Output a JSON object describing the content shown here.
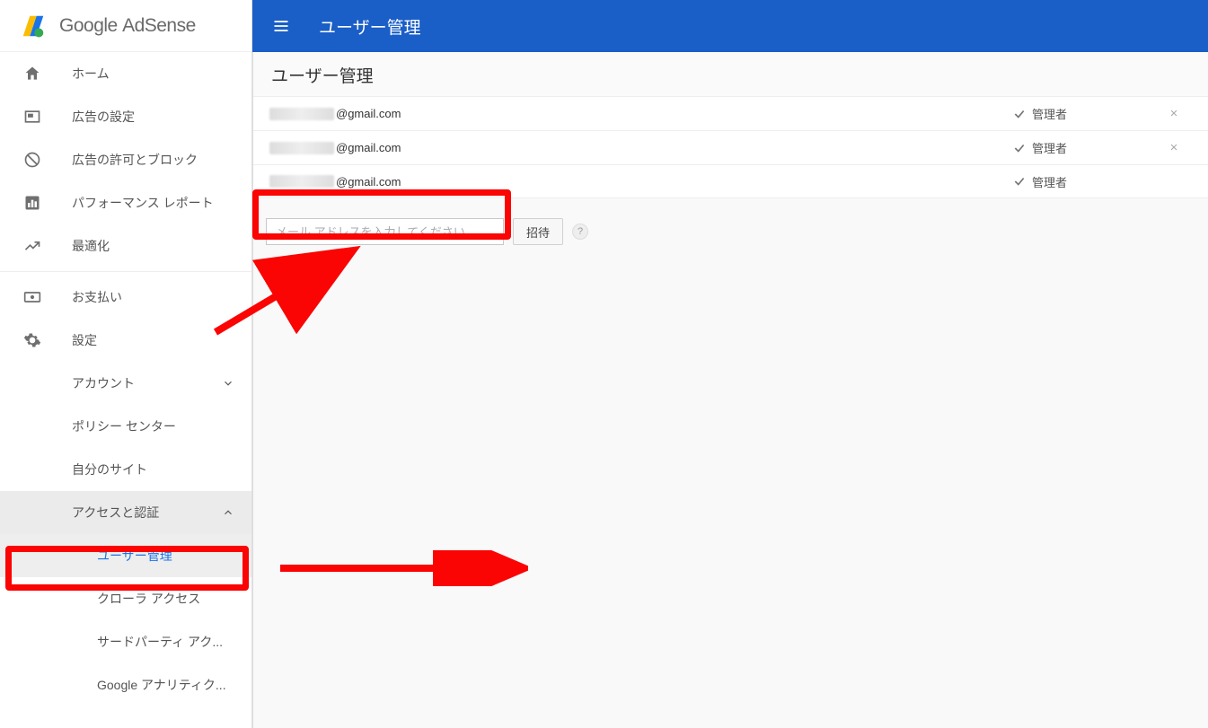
{
  "brand": {
    "google": "Google",
    "product": "AdSense"
  },
  "header": {
    "title": "ユーザー管理"
  },
  "nav": {
    "home": "ホーム",
    "ads": "広告の設定",
    "allow": "広告の許可とブロック",
    "perf": "パフォーマンス レポート",
    "opt": "最適化",
    "pay": "お支払い",
    "settings": "設定",
    "account": "アカウント",
    "policy": "ポリシー センター",
    "mysites": "自分のサイト",
    "access": "アクセスと認証",
    "userMgmt": "ユーザー管理",
    "crawler": "クローラ アクセス",
    "thirdparty": "サードパーティ アク...",
    "analytics": "Google アナリティク..."
  },
  "main": {
    "sectionTitle": "ユーザー管理",
    "adminLabel": "管理者",
    "users": [
      {
        "email": "@gmail.com",
        "removable": true
      },
      {
        "email": "@gmail.com",
        "removable": true
      },
      {
        "email": "@gmail.com",
        "removable": false
      }
    ],
    "emailPlaceholder": "メール アドレスを入力してください",
    "inviteLabel": "招待",
    "helpChar": "?"
  }
}
